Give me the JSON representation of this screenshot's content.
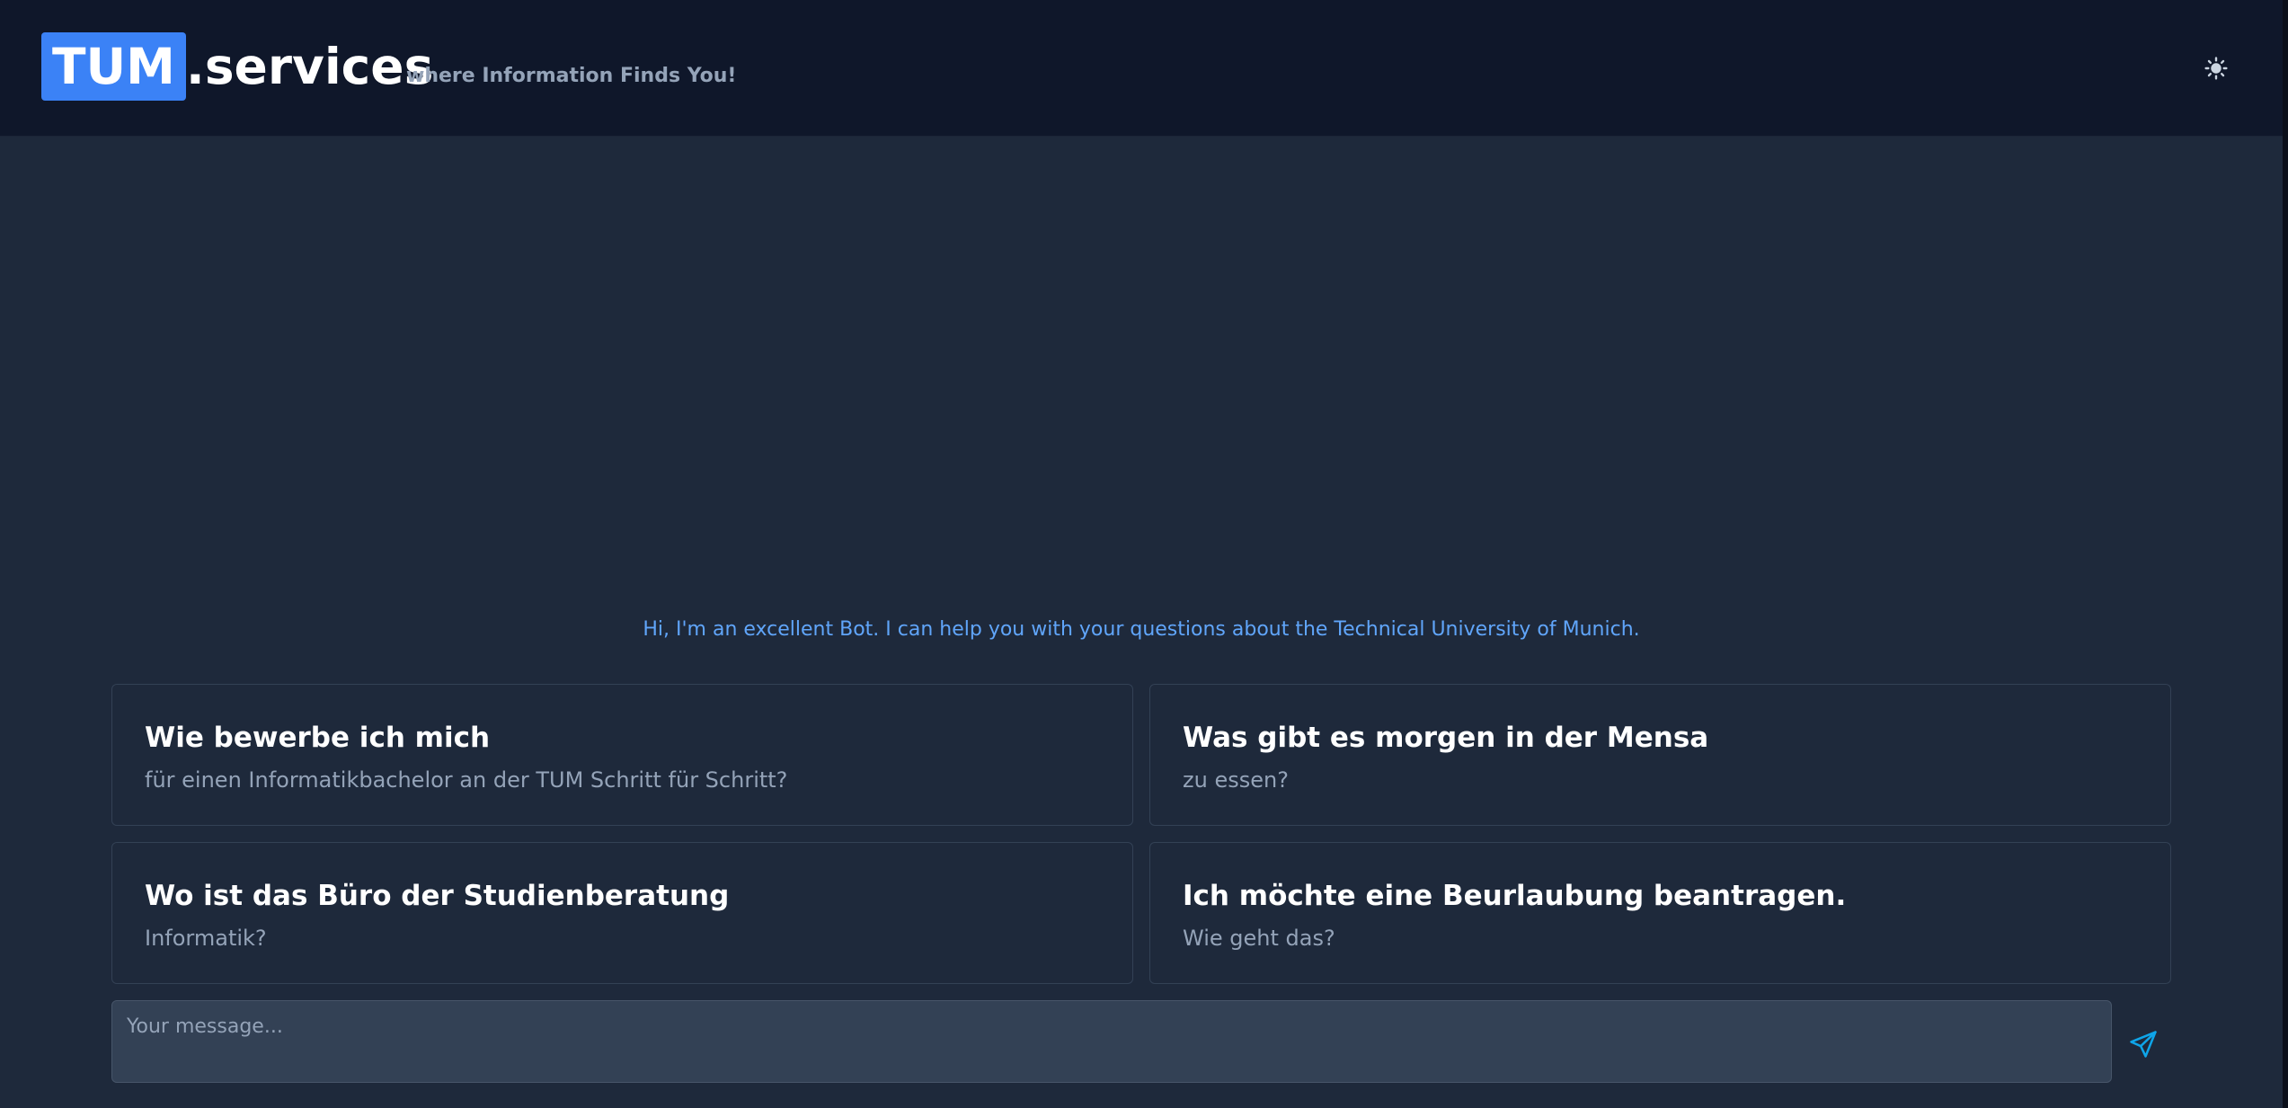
{
  "header": {
    "logo_tum": "TUM",
    "logo_rest": ".services",
    "tagline": "where Information Finds You!",
    "theme_icon": "sun-icon"
  },
  "chat": {
    "intro": "Hi, I'm an excellent Bot. I can help you with your questions about the Technical University of Munich."
  },
  "suggestions": [
    {
      "title": "Wie bewerbe ich mich",
      "subtitle": "für einen Informatikbachelor an der TUM Schritt für Schritt?"
    },
    {
      "title": "Was gibt es morgen in der Mensa",
      "subtitle": "zu essen?"
    },
    {
      "title": "Wo ist das Büro der Studienberatung",
      "subtitle": "Informatik?"
    },
    {
      "title": "Ich möchte eine Beurlaubung beantragen.",
      "subtitle": "Wie geht das?"
    }
  ],
  "composer": {
    "placeholder": "Your message...",
    "value": "",
    "send_icon": "paper-plane-icon"
  },
  "colors": {
    "accent": "#3b82f6",
    "header_bg": "#0f172a",
    "page_bg": "#1e293b",
    "intro_text": "#60a5fa",
    "send_icon": "#0ea5e9"
  }
}
